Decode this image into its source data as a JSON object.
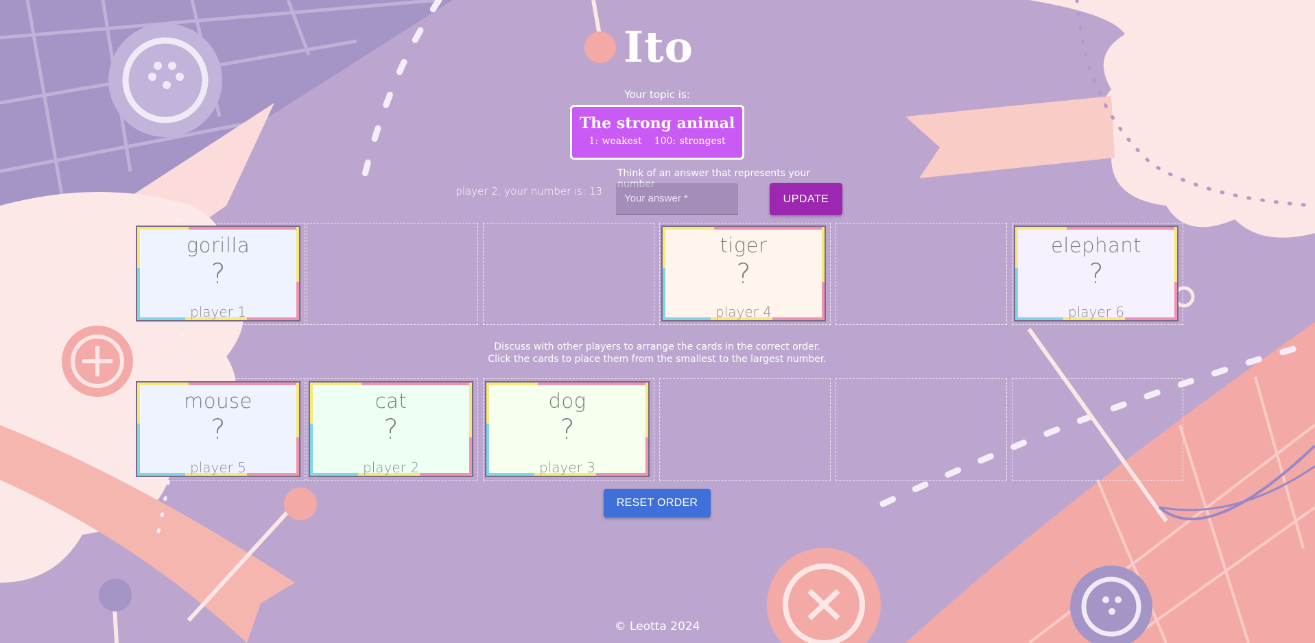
{
  "header": {
    "title": "Ito"
  },
  "topic": {
    "label": "Your topic is:",
    "name": "The strong animal",
    "scale_min": "1: weakest",
    "scale_max": "100: strongest"
  },
  "player": {
    "number_text": "player 2, your number is: 13"
  },
  "answer_form": {
    "hint": "Think of an answer that represents your number",
    "placeholder": "Your answer *",
    "update_label": "UPDATE"
  },
  "board": {
    "top_row": [
      {
        "word": "gorilla",
        "value": "?",
        "owner": "player 1",
        "bg": "#eef3ff"
      },
      null,
      null,
      {
        "word": "tiger",
        "value": "?",
        "owner": "player 4",
        "bg": "#fff5ec"
      },
      null,
      {
        "word": "elephant",
        "value": "?",
        "owner": "player 6",
        "bg": "#f6f0ff"
      }
    ],
    "bottom_row": [
      {
        "word": "mouse",
        "value": "?",
        "owner": "player 5",
        "bg": "#eef3ff"
      },
      {
        "word": "cat",
        "value": "?",
        "owner": "player 2",
        "bg": "#eefff4"
      },
      {
        "word": "dog",
        "value": "?",
        "owner": "player 3",
        "bg": "#f7ffef"
      },
      null,
      null,
      null
    ]
  },
  "instructions": {
    "line1": "Discuss with other players to arrange the cards in the correct order.",
    "line2": "Click the cards to place them from the smallest to the largest number."
  },
  "controls": {
    "reset_label": "RESET ORDER"
  },
  "footer": {
    "text": "© Leotta 2024"
  },
  "colors": {
    "background": "#bca6cf",
    "topic_box": "#c95af3",
    "update_button": "#9c27b0",
    "reset_button": "#3f6fd8",
    "card_stripe_yellow": "#f5e97a",
    "card_stripe_pink": "#ee93b0",
    "card_stripe_cyan": "#7fd6e4"
  }
}
